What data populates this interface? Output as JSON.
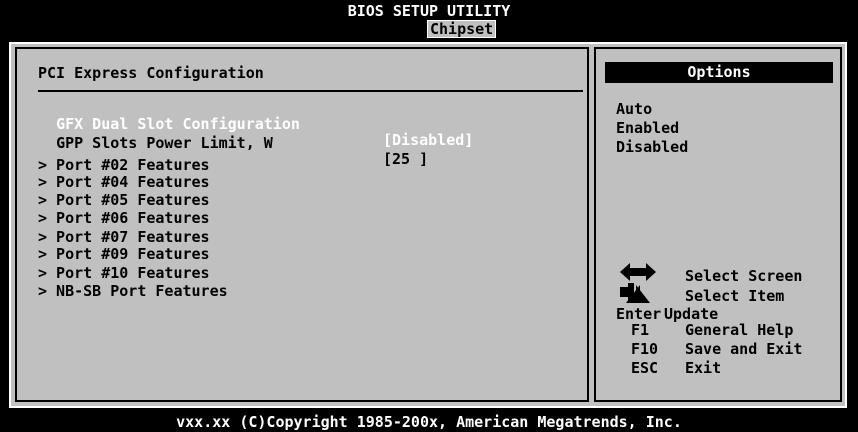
{
  "header": {
    "title": "BIOS SETUP UTILITY",
    "active_tab": "Chipset"
  },
  "main": {
    "section_title": "PCI Express Configuration",
    "settings": [
      {
        "label": "GFX Dual Slot Configuration",
        "value": "[Disabled]",
        "selected": true
      },
      {
        "label": "GPP Slots Power Limit, W",
        "value": "[25 ]",
        "selected": false
      }
    ],
    "submenus": [
      "> Port #02 Features",
      "> Port #04 Features",
      "> Port #05 Features",
      "> Port #06 Features",
      "> Port #07 Features",
      "> Port #09 Features",
      "> Port #10 Features",
      "> NB-SB Port Features"
    ]
  },
  "side": {
    "options_title": "Options",
    "options": [
      "Auto",
      "Enabled",
      "Disabled"
    ],
    "help": [
      {
        "key": "",
        "text": "Select Screen"
      },
      {
        "key": "",
        "text": "Select Item"
      },
      {
        "key": "Enter",
        "text": "Update"
      },
      {
        "key": "F1",
        "text": "General Help"
      },
      {
        "key": "F10",
        "text": "Save and Exit"
      },
      {
        "key": "ESC",
        "text": "Exit"
      }
    ]
  },
  "footer": {
    "copyright": "vxx.xx (C)Copyright 1985-200x, American Megatrends, Inc."
  },
  "colors": {
    "background": "#000000",
    "panel": "#c0c0c0",
    "highlight_text": "#ffffff"
  }
}
